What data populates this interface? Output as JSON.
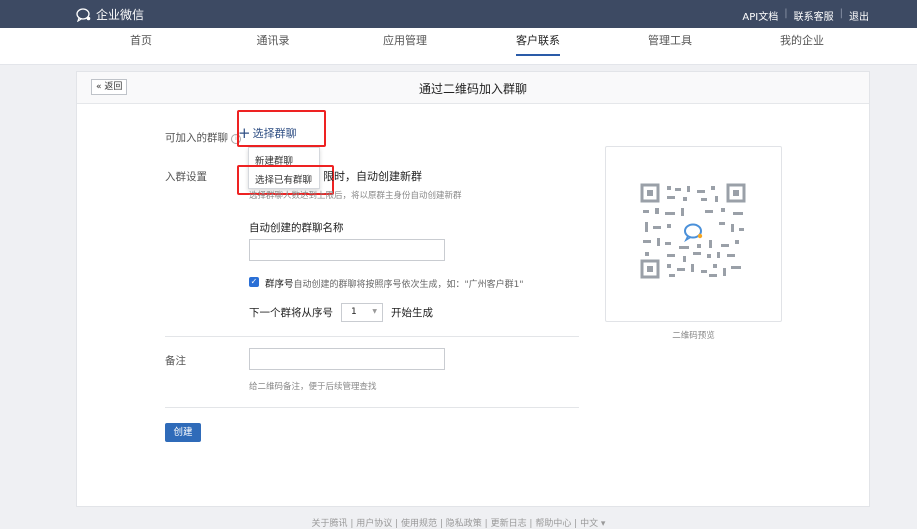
{
  "app": {
    "name": "企业微信"
  },
  "top_links": [
    "API文档",
    "联系客服",
    "退出"
  ],
  "top_separator": "|",
  "nav": {
    "items": [
      {
        "label": "首页"
      },
      {
        "label": "通讯录"
      },
      {
        "label": "应用管理"
      },
      {
        "label": "客户联系",
        "active": true
      },
      {
        "label": "管理工具"
      },
      {
        "label": "我的企业"
      }
    ]
  },
  "page": {
    "back_label": "« 返回",
    "title": "通过二维码加入群聊"
  },
  "form": {
    "group_label": "可加入的群聊",
    "help_icon": "i",
    "select_group": "选择群聊",
    "dropdown_items": [
      "新建群聊",
      "选择已有群聊"
    ],
    "join_settings_label": "入群设置",
    "limit_text": "限时，自动创建新群",
    "limit_hint": "选择群聊人数达到上限后，将以原群主身份自动创建新群",
    "auto_name_label": "自动创建的群聊名称",
    "auto_name_value": "",
    "checkbox_checked": true,
    "checkbox_text_strong": "群序号",
    "checkbox_text": "自动创建的群聊将按照序号依次生成，如：\"广州客户群1\"",
    "next_seq_prefix": "下一个群将从序号",
    "next_seq_value": "1",
    "next_seq_suffix": "开始生成",
    "remark_label": "备注",
    "remark_value": "",
    "remark_hint": "给二维码备注，便于后续管理查找",
    "create_button": "创建"
  },
  "qr": {
    "caption": "二维码预览"
  },
  "footer": {
    "text": "关于腾讯 | 用户协议 | 使用规范 | 隐私政策 | 更新日志 | 帮助中心 | 中文 ▾"
  },
  "colors": {
    "topbar": "#3d4a63",
    "accent": "#2f6bb9",
    "highlight": "#e22222"
  }
}
